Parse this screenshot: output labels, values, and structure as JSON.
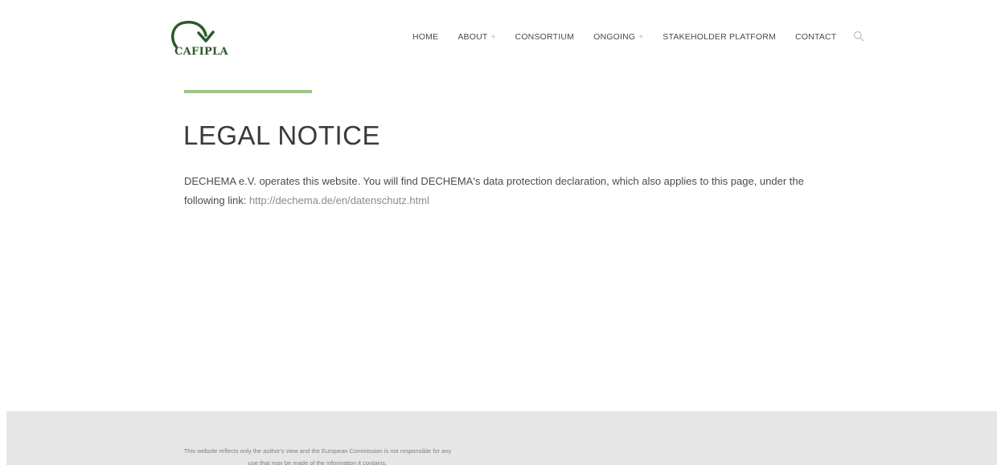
{
  "header": {
    "logo_text": "CAFIPLA",
    "nav": {
      "home": "HOME",
      "about": "ABOUT",
      "consortium": "CONSORTIUM",
      "ongoing": "ONGOING",
      "stakeholder": "STAKEHOLDER PLATFORM",
      "contact": "CONTACT"
    },
    "dropdown_glyph": "+",
    "search_icon": "magnifier-icon"
  },
  "main": {
    "title": "LEGAL NOTICE",
    "paragraph_text": "DECHEMA e.V. operates this website. You will find DECHEMA's data protection declaration, which also applies to this page, under the following link: ",
    "link_text": "http://dechema.de/en/datenschutz.html"
  },
  "footer": {
    "disclaimer_line1": "This website reflects only the author's view and the European Commission is not responsible for any",
    "disclaimer_line2": "use that may be made of the information it contains."
  },
  "colors": {
    "accent": "#9ec77f",
    "logo_green": "#2d5a2b",
    "footer_bg": "#e6e6e6"
  }
}
